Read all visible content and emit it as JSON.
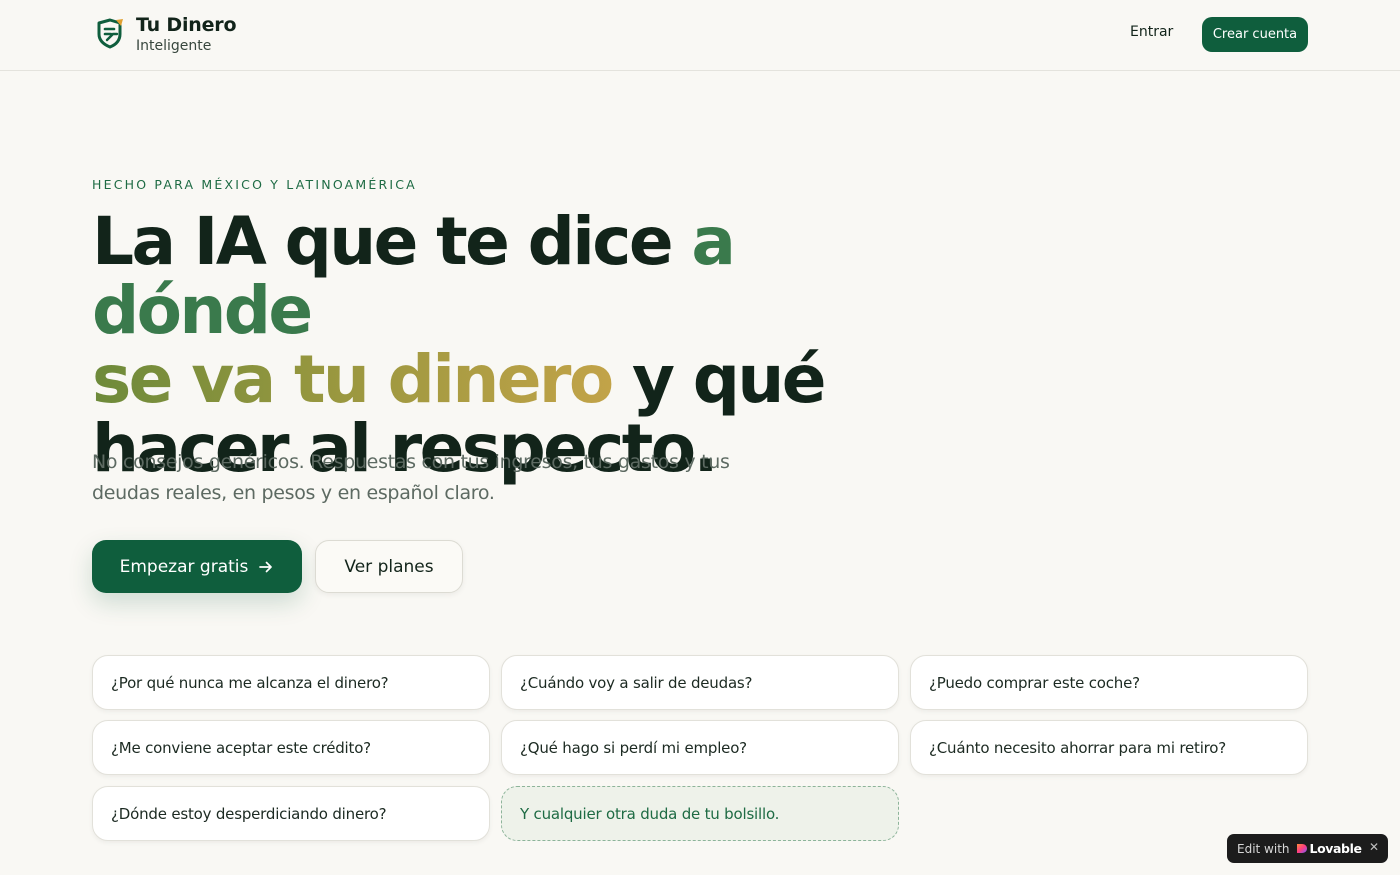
{
  "header": {
    "brand_name": "Tu Dinero",
    "brand_sub": "Inteligente",
    "login_label": "Entrar",
    "signup_label": "Crear cuenta"
  },
  "hero": {
    "eyebrow": "HECHO PARA MÉXICO Y LATINOAMÉRICA",
    "headline_part1": "La IA que te dice ",
    "headline_part2": "a dónde",
    "headline_part3": "se va tu dinero",
    "headline_part4": " y qué",
    "headline_part5": "hacer al respecto.",
    "subtitle": "No consejos genéricos. Respuestas con tus ingresos, tus gastos y tus deudas reales, en pesos y en español claro.",
    "primary_cta": "Empezar gratis",
    "primary_cta_icon": "arrow-right-icon",
    "secondary_cta": "Ver planes"
  },
  "questions": [
    "¿Por qué nunca me alcanza el dinero?",
    "¿Cuándo voy a salir de deudas?",
    "¿Puedo comprar este coche?",
    "¿Me conviene aceptar este crédito?",
    "¿Qué hago si perdí mi empleo?",
    "¿Cuánto necesito ahorrar para mi retiro?",
    "¿Dónde estoy desperdiciando dinero?",
    "Y cualquier otra duda de tu bolsillo."
  ],
  "badge": {
    "prefix": "Edit with",
    "name": "Lovable",
    "close": "✕"
  },
  "colors": {
    "background": "#f9f8f4",
    "primary": "#0f5e3d",
    "accent_green": "#3a7a4c",
    "accent_gold": "#c2a348",
    "text": "#12241a"
  }
}
